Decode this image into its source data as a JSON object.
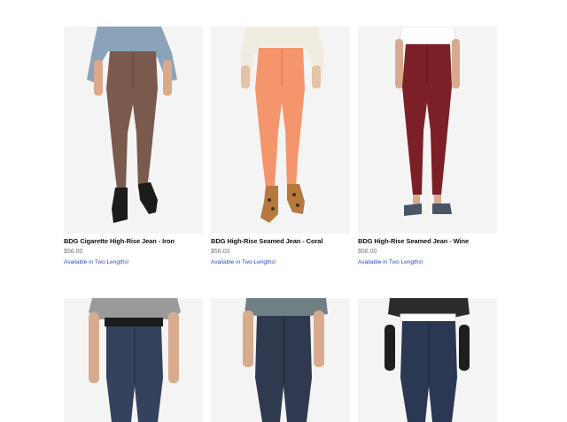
{
  "products": [
    {
      "name": "BDG Cigarette High-Rise Jean - Iron",
      "price": "$56.00",
      "availability": "Available in Two Lengths!",
      "color": "#7a5a4c"
    },
    {
      "name": "BDG High-Rise Seamed Jean - Coral",
      "price": "$56.00",
      "availability": "Available in Two Lengths!",
      "color": "#f5956c"
    },
    {
      "name": "BDG High-Rise Seamed Jean - Wine",
      "price": "$56.00",
      "availability": "Available in Two Lengths!",
      "color": "#7d1f27"
    },
    {
      "color": "#34425e"
    },
    {
      "color": "#2f3a50"
    },
    {
      "color": "#2b3854"
    }
  ]
}
